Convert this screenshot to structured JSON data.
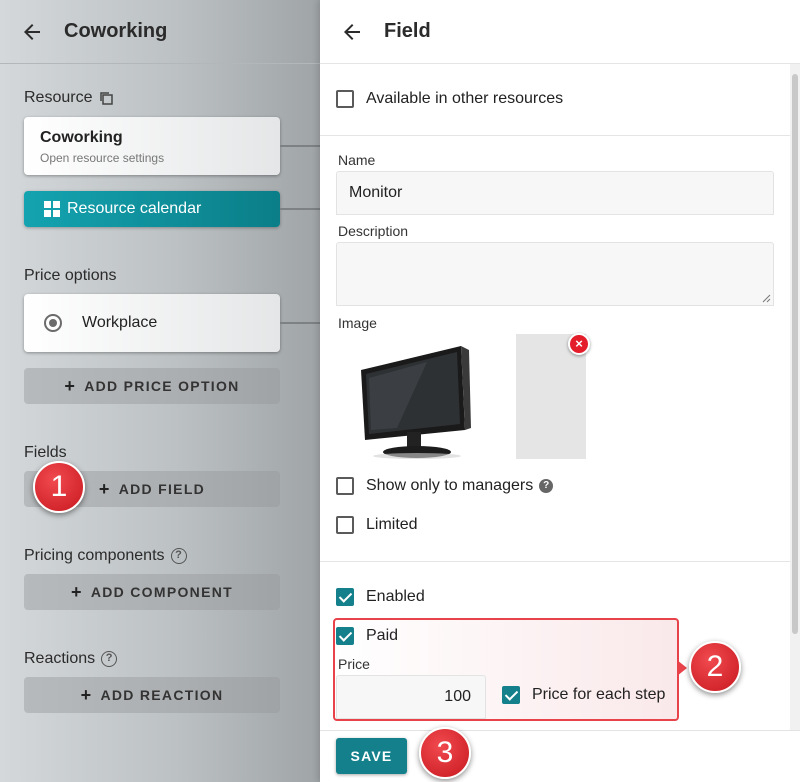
{
  "left_panel": {
    "title": "Coworking",
    "resource": {
      "section_label": "Resource",
      "card_title": "Coworking",
      "card_subtitle": "Open resource settings",
      "calendar_button": "Resource calendar"
    },
    "price_options": {
      "section_label": "Price options",
      "items": [
        "Workplace"
      ],
      "add_button": "ADD PRICE OPTION"
    },
    "fields": {
      "section_label": "Fields",
      "add_button": "ADD FIELD"
    },
    "pricing_components": {
      "section_label": "Pricing components",
      "add_button": "ADD COMPONENT"
    },
    "reactions": {
      "section_label": "Reactions",
      "add_button": "ADD REACTION"
    }
  },
  "right_panel": {
    "title": "Field",
    "available_in_other_resources": {
      "label": "Available in other resources",
      "checked": false
    },
    "name": {
      "label": "Name",
      "value": "Monitor"
    },
    "description": {
      "label": "Description",
      "value": ""
    },
    "image": {
      "label": "Image"
    },
    "show_only_to_managers": {
      "label": "Show only to managers",
      "checked": false
    },
    "limited": {
      "label": "Limited",
      "checked": false
    },
    "enabled": {
      "label": "Enabled",
      "checked": true
    },
    "paid": {
      "label": "Paid",
      "checked": true
    },
    "price": {
      "label": "Price",
      "value": "100"
    },
    "price_for_each_step": {
      "label": "Price for each step",
      "checked": true
    },
    "save_button": "SAVE"
  },
  "step_badges": [
    "1",
    "2",
    "3"
  ],
  "colors": {
    "accent": "#13808b",
    "badge": "#d9252b"
  },
  "icons": [
    "back-arrow-icon",
    "copy-icon",
    "grid-icon",
    "radio-icon",
    "plus-icon",
    "help-icon",
    "remove-icon",
    "resize-icon"
  ]
}
